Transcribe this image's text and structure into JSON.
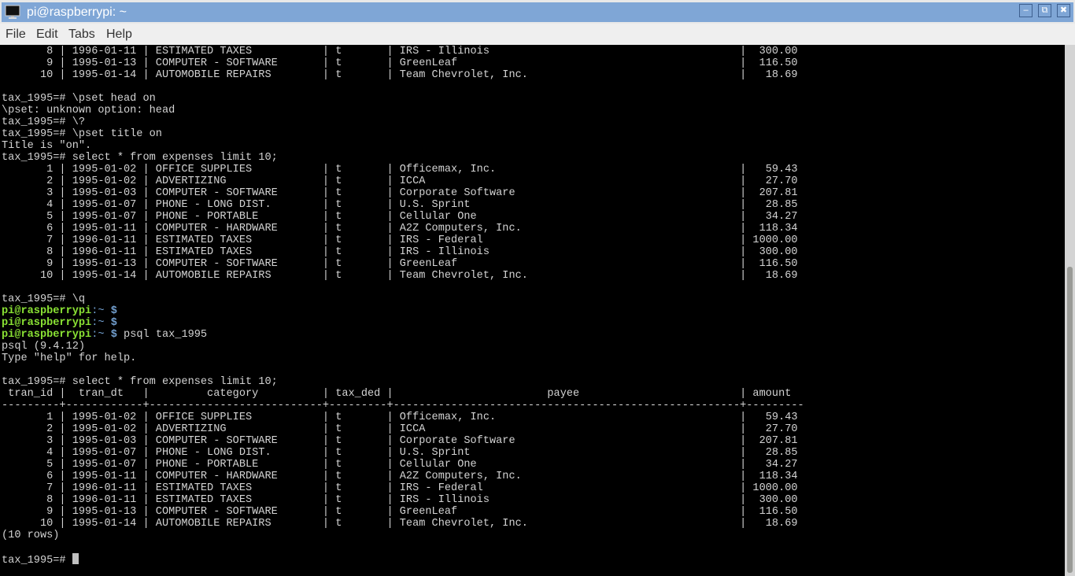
{
  "window": {
    "title": "pi@raspberrypi: ~",
    "icon": "terminal-monitor-icon",
    "buttons": {
      "minimize": "–",
      "restore": "⧉",
      "close": "✖"
    }
  },
  "menubar": {
    "items": [
      "File",
      "Edit",
      "Tabs",
      "Help"
    ]
  },
  "terminal": {
    "lines": [
      "       8 | 1996-01-11 | ESTIMATED TAXES           | t       | IRS - Illinois                                       |  300.00",
      "       9 | 1995-01-13 | COMPUTER - SOFTWARE       | t       | GreenLeaf                                            |  116.50",
      "      10 | 1995-01-14 | AUTOMOBILE REPAIRS        | t       | Team Chevrolet, Inc.                                 |   18.69",
      "",
      "tax_1995=# \\pset head on",
      "\\pset: unknown option: head",
      "tax_1995=# \\?",
      "tax_1995=# \\pset title on",
      "Title is \"on\".",
      "tax_1995=# select * from expenses limit 10;",
      "       1 | 1995-01-02 | OFFICE SUPPLIES           | t       | Officemax, Inc.                                      |   59.43",
      "       2 | 1995-01-02 | ADVERTIZING               | t       | ICCA                                                 |   27.70",
      "       3 | 1995-01-03 | COMPUTER - SOFTWARE       | t       | Corporate Software                                   |  207.81",
      "       4 | 1995-01-07 | PHONE - LONG DIST.        | t       | U.S. Sprint                                          |   28.85",
      "       5 | 1995-01-07 | PHONE - PORTABLE          | t       | Cellular One                                         |   34.27",
      "       6 | 1995-01-11 | COMPUTER - HARDWARE       | t       | A2Z Computers, Inc.                                  |  118.34",
      "       7 | 1996-01-11 | ESTIMATED TAXES           | t       | IRS - Federal                                        | 1000.00",
      "       8 | 1996-01-11 | ESTIMATED TAXES           | t       | IRS - Illinois                                       |  300.00",
      "       9 | 1995-01-13 | COMPUTER - SOFTWARE       | t       | GreenLeaf                                            |  116.50",
      "      10 | 1995-01-14 | AUTOMOBILE REPAIRS        | t       | Team Chevrolet, Inc.                                 |   18.69",
      "",
      "tax_1995=# \\q"
    ],
    "shell_prompts": [
      {
        "user_host": "pi@raspberrypi",
        "path": ":~",
        "symbol": " $",
        "command": ""
      },
      {
        "user_host": "pi@raspberrypi",
        "path": ":~",
        "symbol": " $",
        "command": ""
      },
      {
        "user_host": "pi@raspberrypi",
        "path": ":~",
        "symbol": " $",
        "command": " psql tax_1995"
      }
    ],
    "lines_after": [
      "psql (9.4.12)",
      "Type \"help\" for help.",
      "",
      "tax_1995=# select * from expenses limit 10;",
      " tran_id |  tran_dt   |         category          | tax_ded |                        payee                         | amount",
      "---------+------------+---------------------------+---------+------------------------------------------------------+---------",
      "       1 | 1995-01-02 | OFFICE SUPPLIES           | t       | Officemax, Inc.                                      |   59.43",
      "       2 | 1995-01-02 | ADVERTIZING               | t       | ICCA                                                 |   27.70",
      "       3 | 1995-01-03 | COMPUTER - SOFTWARE       | t       | Corporate Software                                   |  207.81",
      "       4 | 1995-01-07 | PHONE - LONG DIST.        | t       | U.S. Sprint                                          |   28.85",
      "       5 | 1995-01-07 | PHONE - PORTABLE          | t       | Cellular One                                         |   34.27",
      "       6 | 1995-01-11 | COMPUTER - HARDWARE       | t       | A2Z Computers, Inc.                                  |  118.34",
      "       7 | 1996-01-11 | ESTIMATED TAXES           | t       | IRS - Federal                                        | 1000.00",
      "       8 | 1996-01-11 | ESTIMATED TAXES           | t       | IRS - Illinois                                       |  300.00",
      "       9 | 1995-01-13 | COMPUTER - SOFTWARE       | t       | GreenLeaf                                            |  116.50",
      "      10 | 1995-01-14 | AUTOMOBILE REPAIRS        | t       | Team Chevrolet, Inc.                                 |   18.69",
      "(10 rows)",
      ""
    ],
    "current_prompt": "tax_1995=# ",
    "colors": {
      "background": "#000000",
      "foreground": "#d3d3d3",
      "prompt_user": "#8ae234",
      "prompt_symbol": "#729fcf"
    }
  },
  "scrollbar": {
    "scroll_position_fraction": 1.0,
    "visible_fraction": 0.58
  }
}
